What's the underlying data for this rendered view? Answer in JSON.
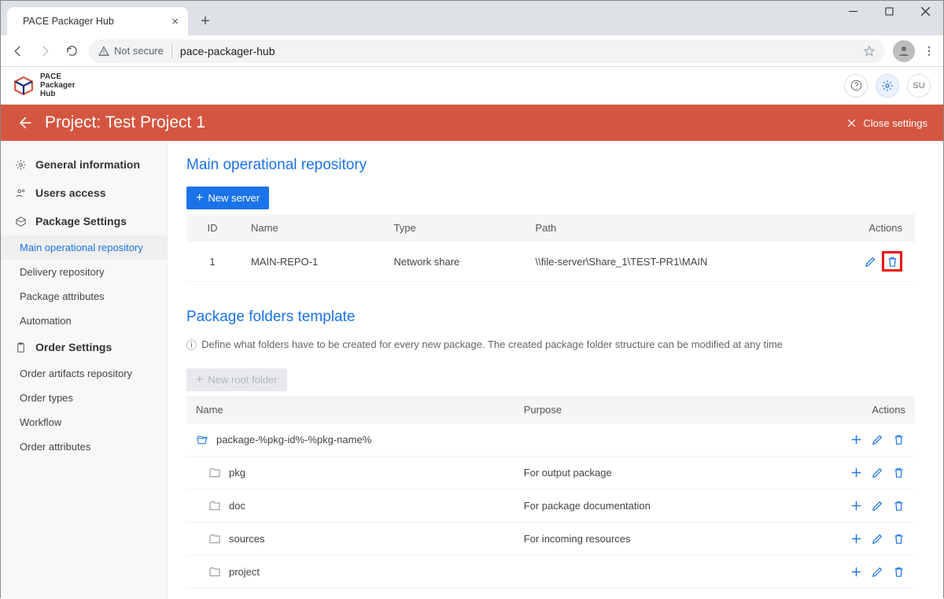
{
  "window": {
    "tab_title": "PACE Packager Hub",
    "not_secure_label": "Not secure",
    "url": "pace-packager-hub"
  },
  "app_header": {
    "branding_lines": [
      "PACE",
      "Packager",
      "Hub"
    ],
    "user_badge": "SU"
  },
  "title_bar": {
    "title": "Project: Test Project 1",
    "close_label": "Close settings"
  },
  "sidebar": {
    "items": [
      {
        "label": "General information"
      },
      {
        "label": "Users access"
      },
      {
        "label": "Package Settings"
      },
      {
        "label": "Main operational repository",
        "sub": true,
        "active": true
      },
      {
        "label": "Delivery repository",
        "sub": true
      },
      {
        "label": "Package attributes",
        "sub": true
      },
      {
        "label": "Automation",
        "sub": true
      },
      {
        "label": "Order Settings"
      },
      {
        "label": "Order artifacts repository",
        "sub": true
      },
      {
        "label": "Order types",
        "sub": true
      },
      {
        "label": "Workflow",
        "sub": true
      },
      {
        "label": "Order attributes",
        "sub": true
      }
    ]
  },
  "main_repo": {
    "section_title": "Main operational repository",
    "new_server_label": "New server",
    "columns": {
      "id": "ID",
      "name": "Name",
      "type": "Type",
      "path": "Path",
      "actions": "Actions"
    },
    "rows": [
      {
        "id": "1",
        "name": "MAIN-REPO-1",
        "type": "Network share",
        "path": "\\\\file-server\\Share_1\\TEST-PR1\\MAIN"
      }
    ]
  },
  "folders": {
    "section_title": "Package folders template",
    "info_text": "Define what folders have to be created for every new package. The created package folder structure can be modified at any time",
    "new_root_label": "New root folder",
    "columns": {
      "name": "Name",
      "purpose": "Purpose",
      "actions": "Actions"
    },
    "rows": [
      {
        "name": "package-%pkg-id%-%pkg-name%",
        "purpose": "",
        "root": true
      },
      {
        "name": "pkg",
        "purpose": "For output package"
      },
      {
        "name": "doc",
        "purpose": "For package documentation"
      },
      {
        "name": "sources",
        "purpose": "For incoming resources"
      },
      {
        "name": "project",
        "purpose": ""
      }
    ]
  }
}
